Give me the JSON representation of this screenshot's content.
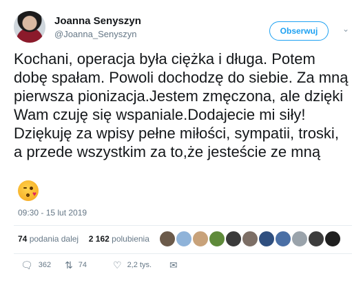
{
  "author": {
    "name": "Joanna Senyszyn",
    "handle": "@Joanna_Senyszyn",
    "follow_label": "Obserwuj"
  },
  "tweet": {
    "text": "Kochani, operacja była ciężka i długa. Potem dobę spałam. Powoli dochodzę do siebie. Za mną pierwsza pionizacja.Jestem zmęczona, ale dzięki Wam czuję się wspaniale.Dodajecie mi siły! Dziękuję za wpisy pełne miłości, sympatii, troski, a przede wszystkim za to,że jesteście ze mną",
    "emoji": "face-blowing-kiss-icon",
    "timestamp": "09:30 - 15 lut 2019"
  },
  "stats": {
    "retweets_count": "74",
    "retweets_label": "podania dalej",
    "likes_count": "2 162",
    "likes_label": "polubienia"
  },
  "likers": [
    "#6b5a4a",
    "#8fb3d9",
    "#c8a27a",
    "#5f8a3a",
    "#3a3a3a",
    "#7d6f66",
    "#2f4f7f",
    "#4a6fa5",
    "#9aa3ab",
    "#3c3c3c",
    "#1f1f1f"
  ],
  "actions": {
    "replies": "362",
    "retweets": "74",
    "likes": "2,2 tys."
  },
  "colors": {
    "accent": "#1da1f2",
    "muted": "#657786",
    "text": "#14171a"
  }
}
